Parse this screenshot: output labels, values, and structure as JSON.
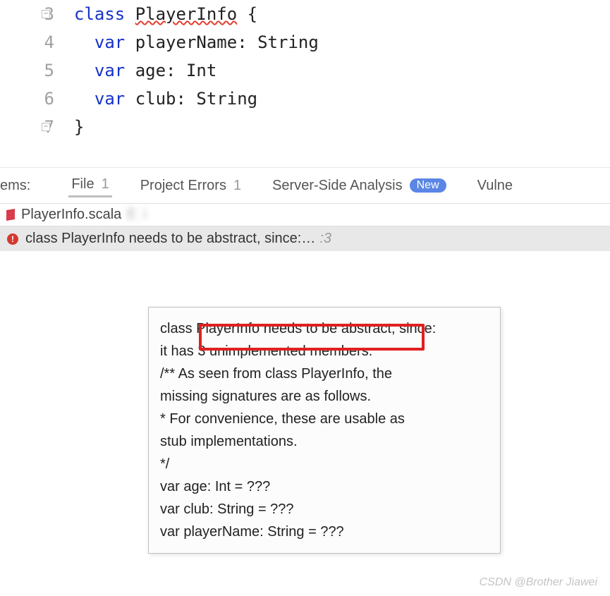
{
  "code": {
    "lines": [
      {
        "n": "3",
        "indent": "",
        "tokens": [
          {
            "t": "class ",
            "c": "kw"
          },
          {
            "t": "PlayerInfo",
            "c": "err-underline"
          },
          {
            "t": " {",
            "c": ""
          }
        ]
      },
      {
        "n": "4",
        "indent": "  ",
        "tokens": [
          {
            "t": "var ",
            "c": "kw"
          },
          {
            "t": "playerName: String",
            "c": ""
          }
        ]
      },
      {
        "n": "5",
        "indent": "  ",
        "tokens": [
          {
            "t": "var ",
            "c": "kw"
          },
          {
            "t": "age: Int",
            "c": ""
          }
        ]
      },
      {
        "n": "6",
        "indent": "  ",
        "tokens": [
          {
            "t": "var ",
            "c": "kw"
          },
          {
            "t": "club: String",
            "c": ""
          }
        ]
      },
      {
        "n": "7",
        "indent": "",
        "tokens": [
          {
            "t": "}",
            "c": ""
          }
        ]
      }
    ]
  },
  "tabs": {
    "ems": "ems:",
    "file": {
      "label": "File",
      "count": "1"
    },
    "project_errors": {
      "label": "Project Errors",
      "count": "1"
    },
    "server": {
      "label": "Server-Side Analysis",
      "badge": "New"
    },
    "vulne": "Vulne"
  },
  "file_tab": {
    "name": "PlayerInfo.scala",
    "rest": "E                                                              i"
  },
  "error": {
    "message": "class PlayerInfo needs to be abstract, since:…",
    "line_ref": ":3"
  },
  "tooltip": {
    "l1": "class PlayerInfo needs to be abstract, since:",
    "l2a": "it has",
    "l2b": " 3 unimplemented members.",
    "l3": "/** As seen from class PlayerInfo, the",
    "l4": "missing signatures are as follows.",
    "l5": "* For convenience, these are usable as",
    "l6": "stub implementations.",
    "l7": "*/",
    "l8": "var age: Int = ???",
    "l9": "var club: String = ???",
    "l10": "var playerName: String = ???"
  },
  "watermark": "CSDN @Brother Jiawei"
}
